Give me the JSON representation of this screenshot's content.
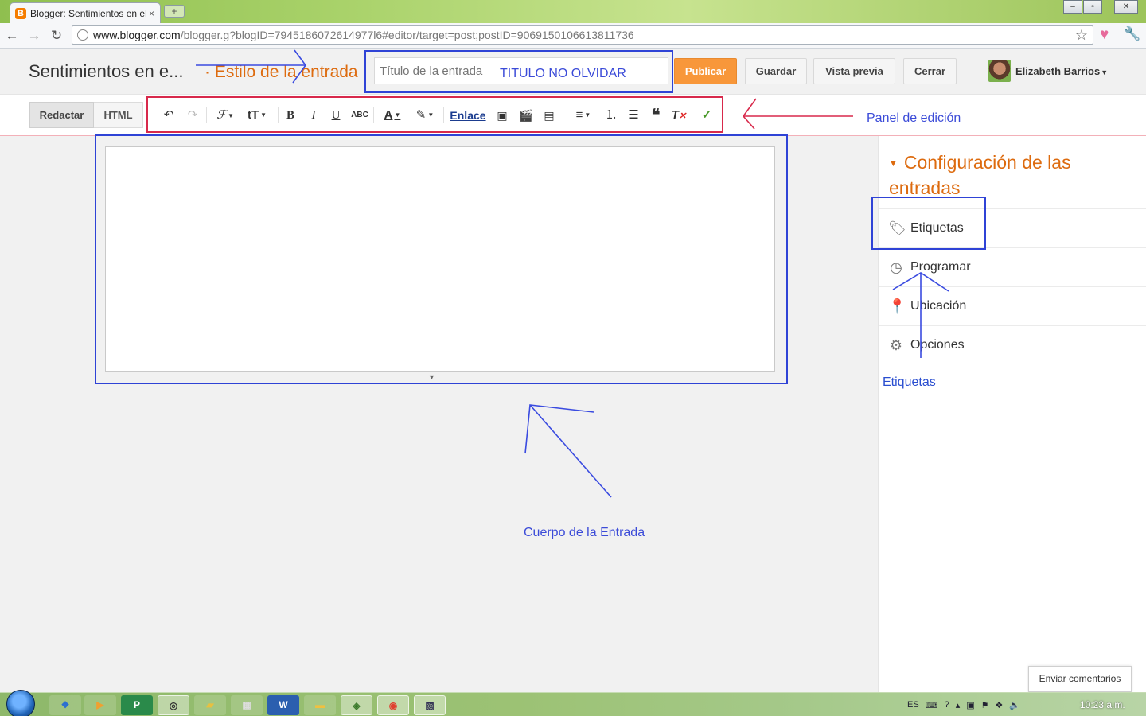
{
  "browser": {
    "tab_title": "Blogger: Sentimientos en el",
    "tab_close": "×",
    "new_tab": "+",
    "url_host": "www.blogger.com",
    "url_path": "/blogger.g?blogID=7945186072614977l6#editor/target=post;postID=9069150106613811736",
    "window_minimize": "–",
    "window_maximize": "▫",
    "window_close": "✕"
  },
  "header": {
    "blog_name": "Sentimientos en e...",
    "separator_style": "· Estilo de la entrada",
    "title_placeholder": "Título de la entrada",
    "title_note": "TITULO NO OLVIDAR",
    "publish_label": "Publicar",
    "save_label": "Guardar",
    "preview_label": "Vista previa",
    "close_label": "Cerrar",
    "user_name": "Elizabeth Barrios"
  },
  "toolbar": {
    "compose_label": "Redactar",
    "html_label": "HTML",
    "link_label": "Enlace"
  },
  "sidebar": {
    "settings_title": "Configuración de las entradas",
    "items": [
      {
        "label": "Etiquetas",
        "icon": "tag-icon"
      },
      {
        "label": "Programar",
        "icon": "clock-icon"
      },
      {
        "label": "Ubicación",
        "icon": "location-pin-icon"
      },
      {
        "label": "Opciones",
        "icon": "gear-icon"
      }
    ],
    "tags_link": "Etiquetas"
  },
  "feedback_label": "Enviar comentarios",
  "annotations": {
    "edit_panel": "Panel de edición",
    "post_body": "Cuerpo de la Entrada",
    "colors": {
      "blue": "#2f43d6",
      "red": "#d8294b"
    }
  },
  "taskbar": {
    "language": "ES",
    "clock": "10:23 a.m."
  }
}
